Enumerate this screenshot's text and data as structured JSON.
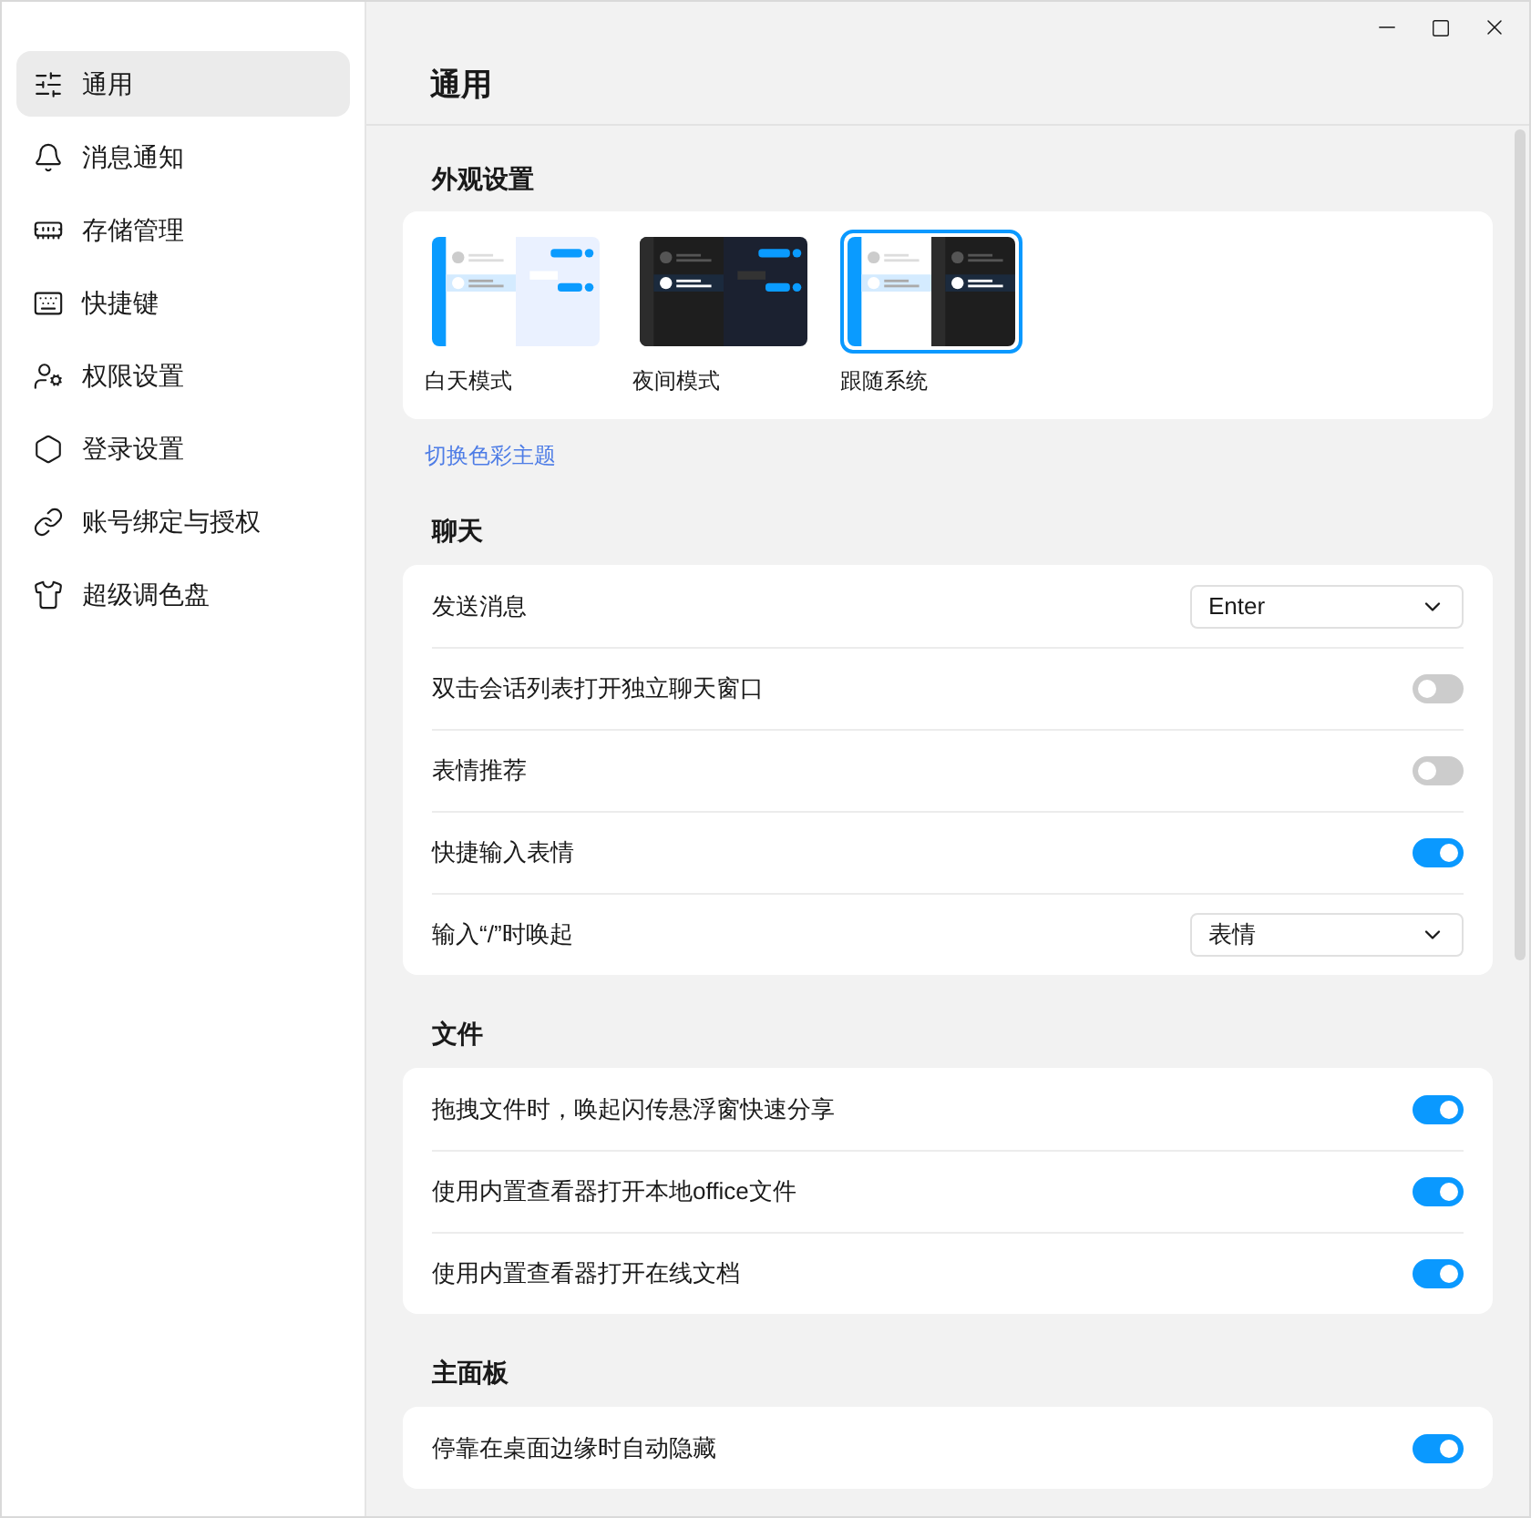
{
  "sidebar": {
    "items": [
      {
        "label": "通用",
        "selected": true
      },
      {
        "label": "消息通知",
        "selected": false
      },
      {
        "label": "存储管理",
        "selected": false
      },
      {
        "label": "快捷键",
        "selected": false
      },
      {
        "label": "权限设置",
        "selected": false
      },
      {
        "label": "登录设置",
        "selected": false
      },
      {
        "label": "账号绑定与授权",
        "selected": false
      },
      {
        "label": "超级调色盘",
        "selected": false
      }
    ]
  },
  "page_title": "通用",
  "appearance": {
    "title": "外观设置",
    "themes": [
      {
        "label": "白天模式",
        "kind": "light",
        "selected": false
      },
      {
        "label": "夜间模式",
        "kind": "dark",
        "selected": false
      },
      {
        "label": "跟随系统",
        "kind": "system",
        "selected": true
      }
    ],
    "link": "切换色彩主题"
  },
  "sections": [
    {
      "title": "聊天",
      "rows": [
        {
          "label": "发送消息",
          "kind": "select",
          "value": "Enter"
        },
        {
          "label": "双击会话列表打开独立聊天窗口",
          "kind": "toggle",
          "on": false
        },
        {
          "label": "表情推荐",
          "kind": "toggle",
          "on": false
        },
        {
          "label": "快捷输入表情",
          "kind": "toggle",
          "on": true
        },
        {
          "label": "输入“/”时唤起",
          "kind": "select",
          "value": "表情"
        }
      ]
    },
    {
      "title": "文件",
      "rows": [
        {
          "label": "拖拽文件时，唤起闪传悬浮窗快速分享",
          "kind": "toggle",
          "on": true
        },
        {
          "label": "使用内置查看器打开本地office文件",
          "kind": "toggle",
          "on": true
        },
        {
          "label": "使用内置查看器打开在线文档",
          "kind": "toggle",
          "on": true
        }
      ]
    },
    {
      "title": "主面板",
      "rows": [
        {
          "label": "停靠在桌面边缘时自动隐藏",
          "kind": "toggle",
          "on": true
        }
      ]
    }
  ]
}
